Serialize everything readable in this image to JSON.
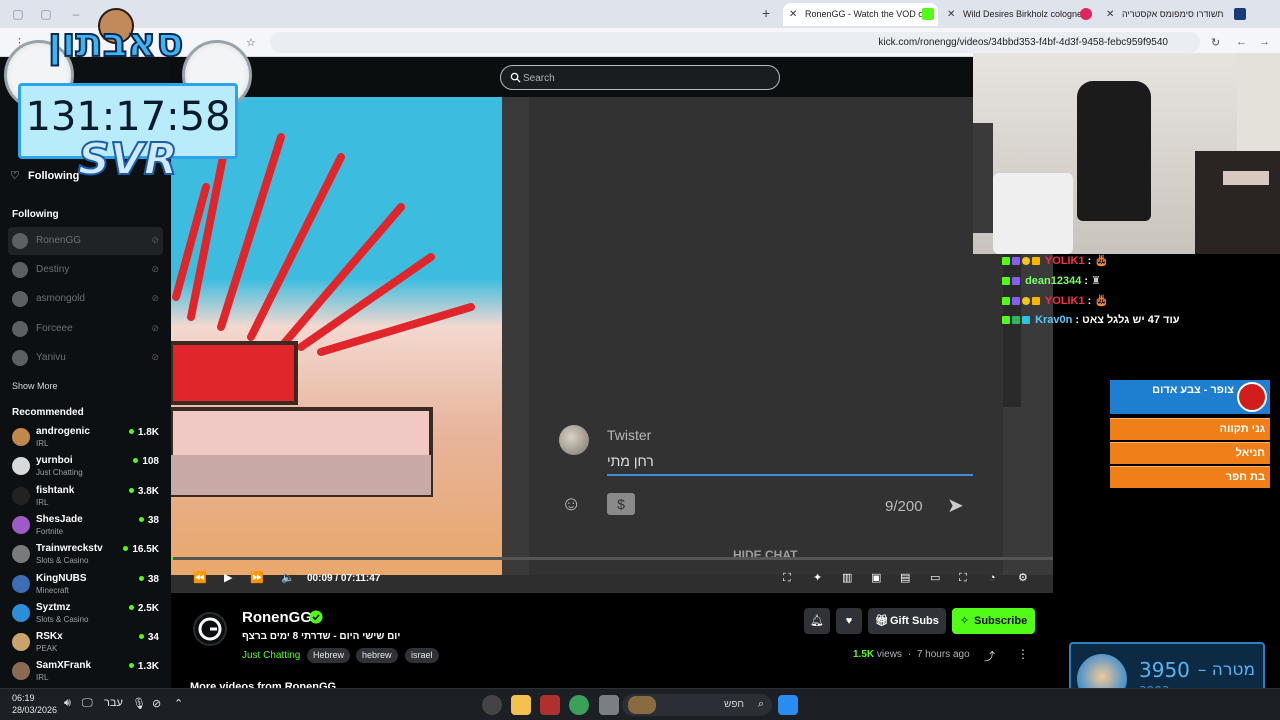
{
  "browser": {
    "tabs": [
      {
        "label": "RonenGG - Watch the VOD on",
        "active": true
      },
      {
        "label": "Wild Desires Birkholz cologne",
        "active": false
      },
      {
        "label": "תשודרו סימפומס אקסטריה",
        "active": false
      }
    ],
    "url": "kick.com/ronengg/videos/34bbd353-f4bf-4d3f-9458-febc959f9540"
  },
  "header": {
    "search_placeholder": "Search"
  },
  "sidebar": {
    "following_button": "Following",
    "following_heading": "Following",
    "following": [
      {
        "name": "RonenGG"
      },
      {
        "name": "Destiny"
      },
      {
        "name": "asmongold"
      },
      {
        "name": "Forceee"
      },
      {
        "name": "Yanivu"
      }
    ],
    "show_more": "Show More",
    "recommended_heading": "Recommended",
    "recommended": [
      {
        "name": "androgenic",
        "category": "IRL",
        "viewers": "1.8K",
        "color": "#c0884a"
      },
      {
        "name": "yurnboi",
        "category": "Just Chatting",
        "viewers": "108",
        "color": "#d9d9d9"
      },
      {
        "name": "fishtank",
        "category": "IRL",
        "viewers": "3.8K",
        "color": "#222222"
      },
      {
        "name": "ShesJade",
        "category": "Fortnite",
        "viewers": "38",
        "color": "#a05ac8"
      },
      {
        "name": "Trainwreckstv",
        "category": "Slots & Casino",
        "viewers": "16.5K",
        "color": "#7a7a7a"
      },
      {
        "name": "KingNUBS",
        "category": "Minecraft",
        "viewers": "38",
        "color": "#3d6db5"
      },
      {
        "name": "Syztmz",
        "category": "Slots & Casino",
        "viewers": "2.5K",
        "color": "#2c8dd8"
      },
      {
        "name": "RSKx",
        "category": "PEAK",
        "viewers": "34",
        "color": "#c9a36a"
      },
      {
        "name": "SamXFrank",
        "category": "IRL",
        "viewers": "1.3K",
        "color": "#8a6a55"
      }
    ]
  },
  "video": {
    "overlay_name": "Twister",
    "overlay_message": "רחן מתי",
    "overlay_counter": "9/200",
    "overlay_hide_chat": "HIDE CHAT",
    "time": "00:09 / 07:11:47",
    "progress": 0.0003
  },
  "channel": {
    "name": "RonenGG",
    "title": "יום שישי היום - שדרתי 8 ימים ברצף",
    "category": "Just Chatting",
    "tags": [
      "Hebrew",
      "hebrew",
      "israel"
    ],
    "gift_label": "Gift Subs",
    "subscribe_label": "Subscribe",
    "views": "1.5K",
    "views_suffix": "views",
    "age": "7 hours ago",
    "more_videos": "More videos from RonenGG"
  },
  "stream_overlay": {
    "timer_title": "סאבתון",
    "timer_time": "131:17:58",
    "timer_tag": "SVR",
    "chat": [
      {
        "user": "YOLIK1",
        "text": ":",
        "color": "#ff2a4a"
      },
      {
        "user": "dean12344",
        "text": ":",
        "color": "#7dff6a"
      },
      {
        "user": "YOLIK1",
        "text": ":",
        "color": "#ff2a4a"
      },
      {
        "user": "Krav0n",
        "text": ": עוד 47 יש גלגל צאט",
        "color": "#5ac8ff"
      }
    ],
    "team_header": "צופר - צבע אדום",
    "teams": [
      "גני תקווה",
      "חניאל",
      "בת חפר"
    ],
    "goal_number": "3950",
    "goal_label": "מטרה",
    "goal_dash": "–",
    "goal_sub": "3903"
  },
  "taskbar": {
    "time": "06:19",
    "date": "28/03/2026",
    "lang": "עבר",
    "search_placeholder": "חפש"
  }
}
